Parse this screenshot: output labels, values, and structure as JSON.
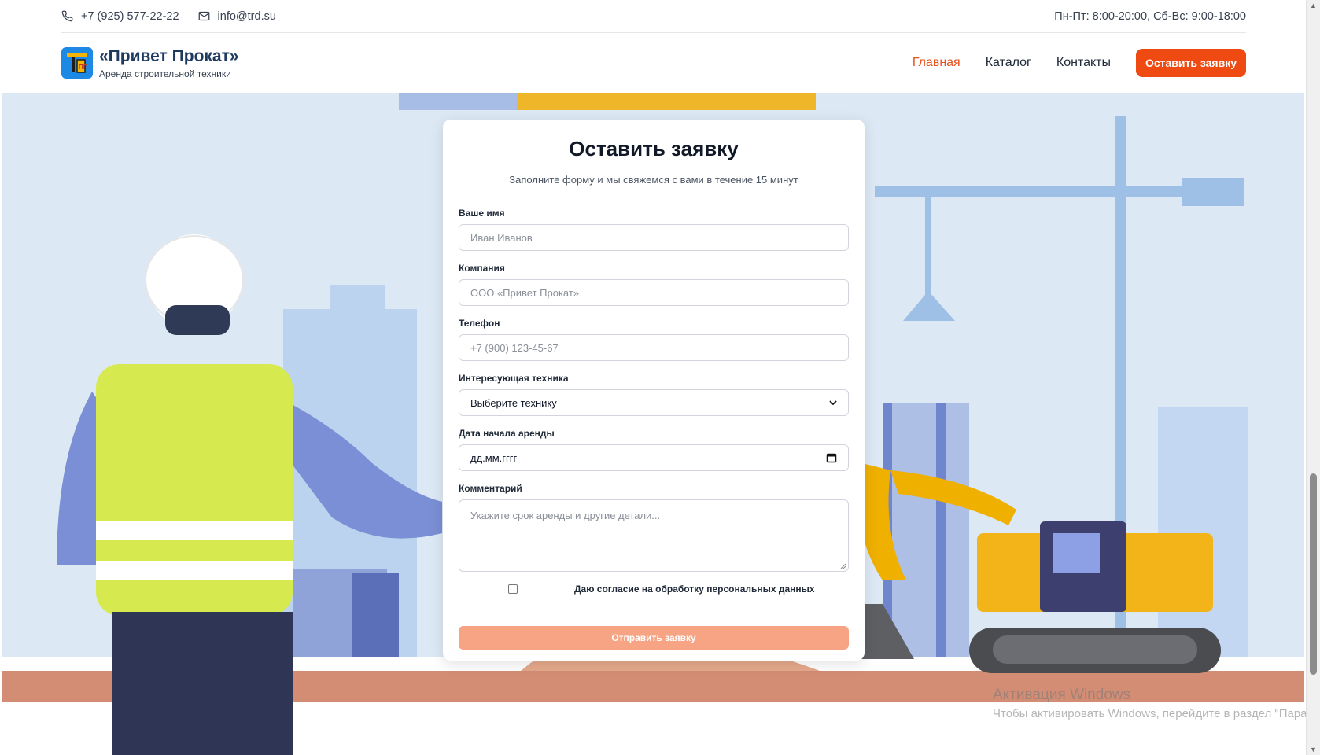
{
  "topbar": {
    "phone": "+7 (925) 577-22-22",
    "email": "info@trd.su",
    "hours": "Пн-Пт: 8:00-20:00, Сб-Вс: 9:00-18:00"
  },
  "header": {
    "brand_title": "«Привет Прокат»",
    "brand_subtitle": "Аренда строительной техники",
    "nav": {
      "home": "Главная",
      "catalog": "Каталог",
      "contacts": "Контакты"
    },
    "cta_label": "Оставить заявку"
  },
  "form": {
    "title": "Оставить заявку",
    "subtitle": "Заполните форму и мы свяжемся с вами в течение 15 минут",
    "name": {
      "label": "Ваше имя",
      "placeholder": "Иван Иванов"
    },
    "company": {
      "label": "Компания",
      "placeholder": "ООО «Привет Прокат»"
    },
    "phone": {
      "label": "Телефон",
      "placeholder": "+7 (900) 123-45-67"
    },
    "equipment": {
      "label": "Интересующая техника",
      "selected": "Выберите технику"
    },
    "start_date": {
      "label": "Дата начала аренды",
      "placeholder": "дд.мм.гггг"
    },
    "comment": {
      "label": "Комментарий",
      "placeholder": "Укажите срок аренды и другие детали..."
    },
    "consent_label": "Даю согласие на обработку персональных данных",
    "consent_checked": false,
    "submit_label": "Отправить заявку"
  },
  "watermark": {
    "line1": "Активация Windows",
    "line2": "Чтобы активировать Windows, перейдите в раздел \"Параме"
  },
  "colors": {
    "accent": "#ee4a12",
    "nav_active": "#e8501c",
    "submit_disabled": "#f6a483",
    "hero_bg": "#dce9f5",
    "logo_bg": "#1e88e5"
  },
  "icons": {
    "phone": "phone-icon",
    "email": "mail-icon",
    "logo": "crane-logo-icon",
    "select": "chevron-down-icon",
    "date": "calendar-icon",
    "resize": "resize-handle-icon"
  }
}
